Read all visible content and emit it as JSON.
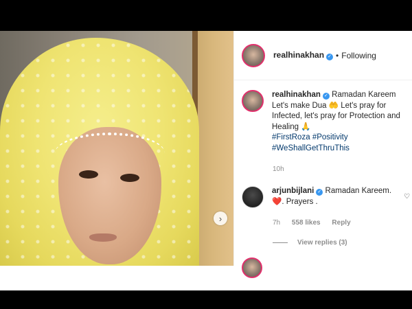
{
  "post": {
    "username": "realhinakhan",
    "follow_status": "Following",
    "separator": "•",
    "verified_icon": "verified-badge-icon"
  },
  "caption": {
    "username": "realhinakhan",
    "text_line1": "Ramadan Kareem",
    "text_line2": "Let's make Dua 🤲 Let's pray for",
    "text_line3": "Infected, let's pray for Protection and",
    "text_line4": "Healing 🙏",
    "hashtags": [
      "#FirstRoza",
      "#Positivity",
      "#WeShallGetThruThis"
    ],
    "time": "10h"
  },
  "comment": {
    "username": "arjunbijlani",
    "text_line1": "Ramadan Kareem.",
    "text_line2": "❤️. Prayers .",
    "time": "7h",
    "likes": "558 likes",
    "reply_label": "Reply",
    "heart_icon": "♡"
  },
  "view_replies": "View replies (3)",
  "carousel_next_icon": "›"
}
